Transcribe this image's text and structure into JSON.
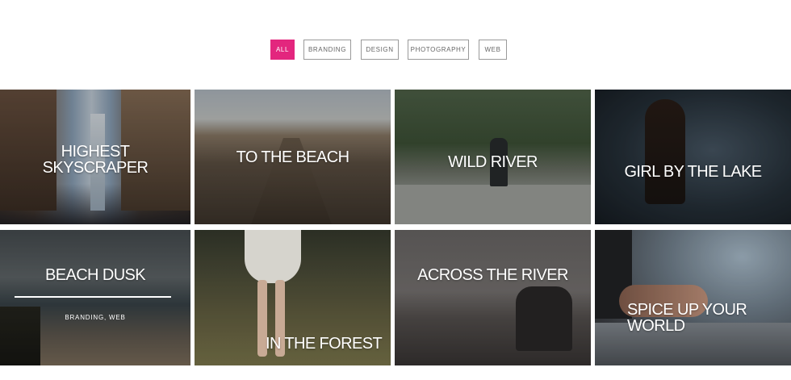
{
  "filters": [
    {
      "label": "All",
      "active": true
    },
    {
      "label": "Branding",
      "active": false
    },
    {
      "label": "Design",
      "active": false
    },
    {
      "label": "Photography",
      "active": false
    },
    {
      "label": "Web",
      "active": false
    }
  ],
  "portfolio": {
    "items": [
      {
        "title": "HIGHEST\nSKYSCRAPER"
      },
      {
        "title": "TO THE BEACH"
      },
      {
        "title": "WILD RIVER"
      },
      {
        "title": "GIRL BY THE LAKE"
      },
      {
        "title": "BEACH DUSK",
        "categories": "BRANDING, WEB"
      },
      {
        "title": "IN THE FOREST"
      },
      {
        "title": "ACROSS THE RIVER"
      },
      {
        "title": "SPICE UP YOUR\nWORLD"
      }
    ]
  }
}
